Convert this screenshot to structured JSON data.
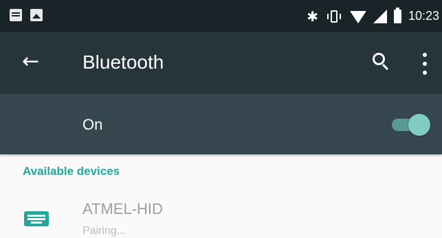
{
  "status_bar": {
    "left_icons": [
      "message-icon",
      "image-icon"
    ],
    "right_icons": [
      "bluetooth-icon",
      "vibrate-icon",
      "wifi-icon",
      "cell-signal-icon",
      "battery-icon"
    ],
    "bluetooth_glyph": "✱",
    "time": "10:23"
  },
  "app_bar": {
    "back_glyph": "←",
    "title": "Bluetooth",
    "actions": [
      "search-icon",
      "more-vert-icon"
    ]
  },
  "toggle": {
    "label": "On",
    "state": "on",
    "accent_color": "#80cbc4"
  },
  "available_devices": {
    "header": "Available devices",
    "header_color": "#26a69a",
    "items": [
      {
        "icon": "keyboard-icon",
        "name": "ATMEL-HID",
        "status": "Pairing..."
      }
    ]
  },
  "colors": {
    "status_bar_bg": "#192428",
    "app_bar_bg": "#26353b",
    "toggle_row_bg": "#37474f",
    "page_bg": "#fafafa"
  }
}
